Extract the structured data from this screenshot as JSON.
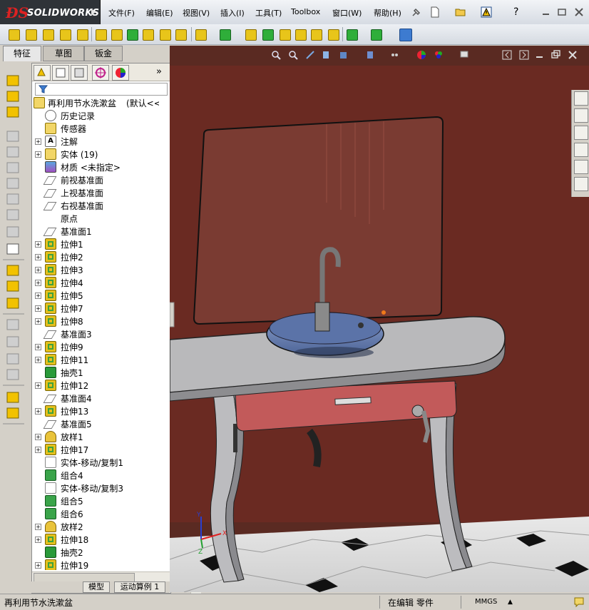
{
  "app": {
    "brand": "SOLIDWORKS"
  },
  "menu": [
    {
      "label": "文件(F)"
    },
    {
      "label": "编辑(E)"
    },
    {
      "label": "视图(V)"
    },
    {
      "label": "插入(I)"
    },
    {
      "label": "工具(T)"
    },
    {
      "label": "Toolbox"
    },
    {
      "label": "窗口(W)"
    },
    {
      "label": "帮助(H)"
    }
  ],
  "command_tabs": [
    {
      "label": "特征",
      "active": true
    },
    {
      "label": "草图",
      "active": false
    },
    {
      "label": "钣金",
      "active": false
    }
  ],
  "feature_tree": {
    "root": "再利用节水洗漱盆",
    "root_config": "(默认<<默",
    "items": [
      {
        "label": "历史记录",
        "icon": "history-icon",
        "expandable": false
      },
      {
        "label": "传感器",
        "icon": "sensor-icon",
        "expandable": false
      },
      {
        "label": "注解",
        "icon": "annotation-icon",
        "expandable": true
      },
      {
        "label": "实体 (19)",
        "icon": "solid-bodies-folder-icon",
        "expandable": true
      },
      {
        "label": "材质 <未指定>",
        "icon": "material-icon",
        "expandable": false
      },
      {
        "label": "前视基准面",
        "icon": "plane-icon",
        "expandable": false
      },
      {
        "label": "上视基准面",
        "icon": "plane-icon",
        "expandable": false
      },
      {
        "label": "右视基准面",
        "icon": "plane-icon",
        "expandable": false
      },
      {
        "label": "原点",
        "icon": "origin-icon",
        "expandable": false
      },
      {
        "label": "基准面1",
        "icon": "plane-icon",
        "expandable": false
      },
      {
        "label": "拉伸1",
        "icon": "extrude-icon",
        "expandable": true
      },
      {
        "label": "拉伸2",
        "icon": "extrude-icon",
        "expandable": true
      },
      {
        "label": "拉伸3",
        "icon": "extrude-icon",
        "expandable": true
      },
      {
        "label": "拉伸4",
        "icon": "extrude-icon",
        "expandable": true
      },
      {
        "label": "拉伸5",
        "icon": "extrude-icon",
        "expandable": true
      },
      {
        "label": "拉伸7",
        "icon": "extrude-icon",
        "expandable": true
      },
      {
        "label": "拉伸8",
        "icon": "extrude-icon",
        "expandable": true
      },
      {
        "label": "基准面3",
        "icon": "plane-icon",
        "expandable": false
      },
      {
        "label": "拉伸9",
        "icon": "extrude-icon",
        "expandable": true
      },
      {
        "label": "拉伸11",
        "icon": "extrude-icon",
        "expandable": true
      },
      {
        "label": "抽壳1",
        "icon": "shell-icon",
        "expandable": false
      },
      {
        "label": "拉伸12",
        "icon": "extrude-icon",
        "expandable": true
      },
      {
        "label": "基准面4",
        "icon": "plane-icon",
        "expandable": false
      },
      {
        "label": "拉伸13",
        "icon": "extrude-icon",
        "expandable": true
      },
      {
        "label": "基准面5",
        "icon": "plane-icon",
        "expandable": false
      },
      {
        "label": "放样1",
        "icon": "loft-icon",
        "expandable": true
      },
      {
        "label": "拉伸17",
        "icon": "extrude-icon",
        "expandable": true
      },
      {
        "label": "实体-移动/复制1",
        "icon": "move-copy-icon",
        "expandable": false
      },
      {
        "label": "组合4",
        "icon": "combine-icon",
        "expandable": false
      },
      {
        "label": "实体-移动/复制3",
        "icon": "move-copy-icon",
        "expandable": false
      },
      {
        "label": "组合5",
        "icon": "combine-icon",
        "expandable": false
      },
      {
        "label": "组合6",
        "icon": "combine-icon",
        "expandable": false
      },
      {
        "label": "放样2",
        "icon": "loft-icon",
        "expandable": true
      },
      {
        "label": "拉伸18",
        "icon": "extrude-icon",
        "expandable": true
      },
      {
        "label": "抽壳2",
        "icon": "shell-icon",
        "expandable": false
      },
      {
        "label": "拉伸19",
        "icon": "extrude-icon",
        "expandable": true
      }
    ]
  },
  "bottom_tabs": [
    {
      "label": "模型",
      "active": true
    },
    {
      "label": "运动算例 1",
      "active": false
    }
  ],
  "status": {
    "part_name": "再利用节水洗漱盆",
    "editing": "在编辑 零件",
    "units": "MMGS"
  },
  "colors": {
    "viewport_bg": "#5a2a22",
    "wall": "#6a2a22",
    "counter": "#b9b9bb",
    "basin": "#6e87b8",
    "drawer": "#c25a5a",
    "mirror": "#7a3b32"
  }
}
